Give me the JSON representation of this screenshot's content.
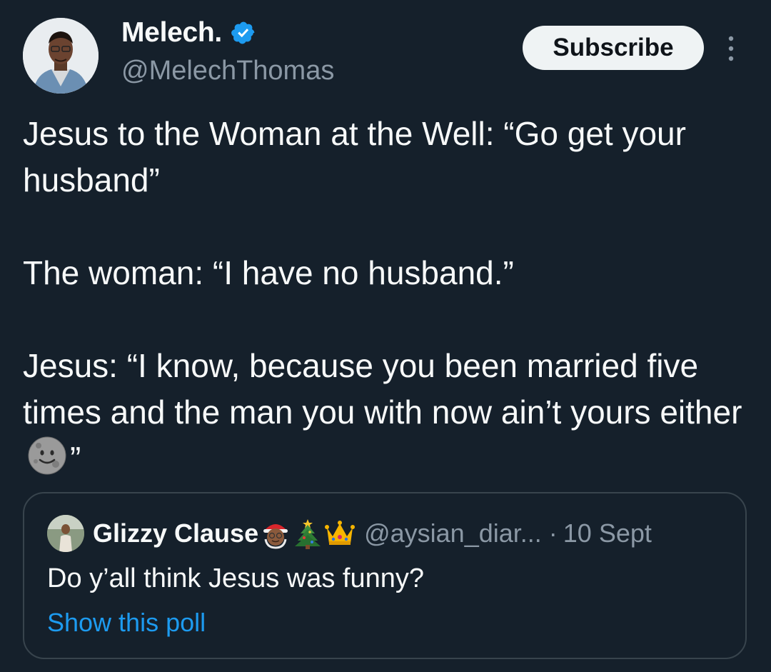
{
  "tweet": {
    "author": {
      "display_name": "Melech.",
      "handle": "@MelechThomas",
      "verified": true,
      "verified_color": "#1d9bf0"
    },
    "subscribe_label": "Subscribe",
    "more_icon": "more-vertical-icon",
    "body": {
      "line1": "Jesus to the Woman at the Well: “Go get your husband”",
      "line2": "The woman: “I have no husband.”",
      "line3_before_emoji": "Jesus: “I know, because you been married five times and the man you with now ain’t yours either",
      "line3_emoji": "new-moon-face-emoji",
      "line3_after_emoji": "”"
    }
  },
  "quoted": {
    "display_name": "Glizzy Clause",
    "name_emojis": [
      "mrs-claus-emoji",
      "christmas-tree-emoji",
      "crown-emoji"
    ],
    "handle": "@aysian_diar...",
    "separator": "·",
    "date": "10 Sept",
    "text": "Do y’all think Jesus was funny?",
    "link_label": "Show this poll",
    "link_color": "#1d9bf0"
  },
  "colors": {
    "background": "#15202b",
    "text": "#f7f9f9",
    "secondary_text": "#8b98a5",
    "border": "#38444d"
  }
}
